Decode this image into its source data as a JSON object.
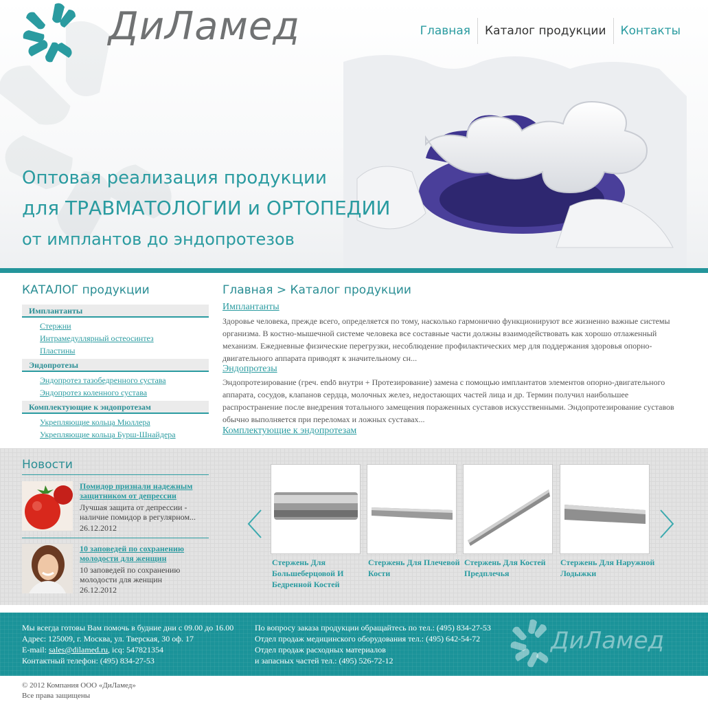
{
  "brand": {
    "name": "ДиЛамед",
    "teal": "#2a9ba0",
    "footer_teal": "#1b9399"
  },
  "nav": [
    {
      "label": "Главная"
    },
    {
      "label": "Каталог продукции"
    },
    {
      "label": "Контакты"
    }
  ],
  "hero": {
    "line1": "Оптовая реализация продукции",
    "line2": "для ТРАВМАТОЛОГИИ и ОРТОПЕДИИ",
    "line3": "от имплантов до эндопротезов"
  },
  "catalog": {
    "title": "КАТАЛОГ продукции",
    "groups": [
      {
        "label": "Имплантанты",
        "items": [
          "Стержни",
          "Интрамедуллярный остеосинтез",
          "Пластины"
        ]
      },
      {
        "label": "Эндопротезы",
        "items": [
          "Эндопротез тазобедренного сустава",
          "Эндопротез коленного сустава"
        ]
      },
      {
        "label": "Комплектующие к эндопротезам",
        "items": [
          "Укрепляющие кольца Мюллера",
          "Укрепляющие кольца Бурш-Шнайдера"
        ]
      }
    ]
  },
  "main": {
    "breadcrumb": "Главная > Каталог продукции",
    "sections": [
      {
        "title": "Имплантанты",
        "text": "Здоровье человека, прежде всего, определяется по тому, насколько гармонично функционируют все жизненно важные системы организма. В костно-мышечной системе человека все составные части должны взаимодействовать как хорошо отлаженный механизм. Ежедневные физические перегрузки, несоблюдение профилактических мер для поддержания здоровья опорно-двигательного аппарата приводят к значительному сн..."
      },
      {
        "title": "Эндопротезы",
        "text": "Эндопротезирование (греч. endō внутри + Протезирование) замена с помощью имплантатов элементов опорно-двигательного аппарата, сосудов, клапанов сердца, молочных желез, недостающих частей лица и др. Термин получил наибольшее распространение после внедрения тотального замещения пораженных суставов искусственными. Эндопротезирование суставов обычно выполняется при переломах и ложных суставах..."
      },
      {
        "title": "Комплектующие к эндопротезам",
        "text": ""
      }
    ]
  },
  "news": {
    "title": "Новости",
    "items": [
      {
        "headline": "Помидор признали надежным защитником от депрессии",
        "summary": "Лучшая защита от депрессии - наличие помидор в регулярном...",
        "date": "26.12.2012",
        "image": "tomato-photo"
      },
      {
        "headline": "10 заповедей по сохранению молодости для женщин",
        "summary": "10 заповедей по сохранению молодости для женщин",
        "date": "26.12.2012",
        "image": "woman-photo"
      }
    ]
  },
  "products": [
    {
      "name": "Стержень Для Большеберцовой И Бедренной Костей"
    },
    {
      "name": "Стержень Для Плечевой Кости"
    },
    {
      "name": "Стержень Для Костей Предплечья"
    },
    {
      "name": "Стержень Для Наружной Лодыжки"
    }
  ],
  "footer": {
    "col1": [
      "Мы всегда готовы Вам помочь в будние дни с 09.00 до 16.00",
      "Адрес: 125009, г. Москва, ул. Тверская, 30 оф. 17"
    ],
    "email_prefix": "E-mail: ",
    "email": "sales@dilamed.ru",
    "icq": ", icq: 547821354",
    "phone": "Контактный телефон: (495) 834-27-53",
    "col2": [
      "По вопросу заказа продукции обращайтесь по тел.: (495) 834-27-53",
      "Отдел продаж медицинского оборудования тел.: (495) 642-54-72",
      "Отдел продаж расходных материалов",
      "и запасных частей тел.: (495) 526-72-12"
    ],
    "logo_text": "ДиЛамед"
  },
  "copyright": {
    "line1": "© 2012 Компания ООО «ДиЛамед»",
    "line2": "Все права защищены"
  }
}
